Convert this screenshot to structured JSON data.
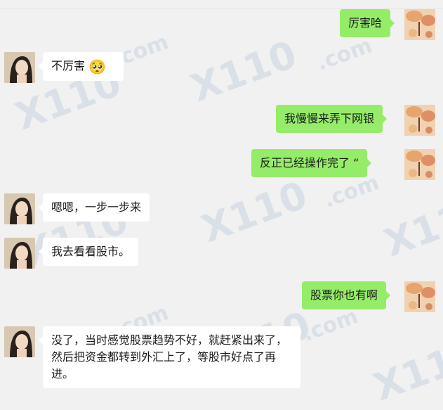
{
  "chat": {
    "messages": [
      {
        "side": "right",
        "text": "厉害哈"
      },
      {
        "side": "left",
        "text": "不厉害",
        "emoji": "🥺"
      },
      {
        "side": "right",
        "text": "我慢慢来弄下网银"
      },
      {
        "side": "right",
        "text": "反正已经操作完了 “"
      },
      {
        "side": "left",
        "text": "嗯嗯，一步一步来"
      },
      {
        "side": "left",
        "text": "我去看看股市。"
      },
      {
        "side": "right",
        "text": "股票你也有啊"
      },
      {
        "side": "left",
        "text": "没了，当时感觉股票趋势不好，就赶紧出来了，然后把资金都转到外汇上了，等股市好点了再进。"
      }
    ]
  },
  "watermark": {
    "big": "X110",
    "small": ".com"
  },
  "colors": {
    "background": "#f1f1f1",
    "bubble_self": "#95ec69",
    "bubble_other": "#ffffff"
  },
  "icons": {
    "avatar_left": "woman-portrait-avatar",
    "avatar_right": "autumn-landscape-avatar",
    "emoji": "pleading-face-emoji"
  }
}
